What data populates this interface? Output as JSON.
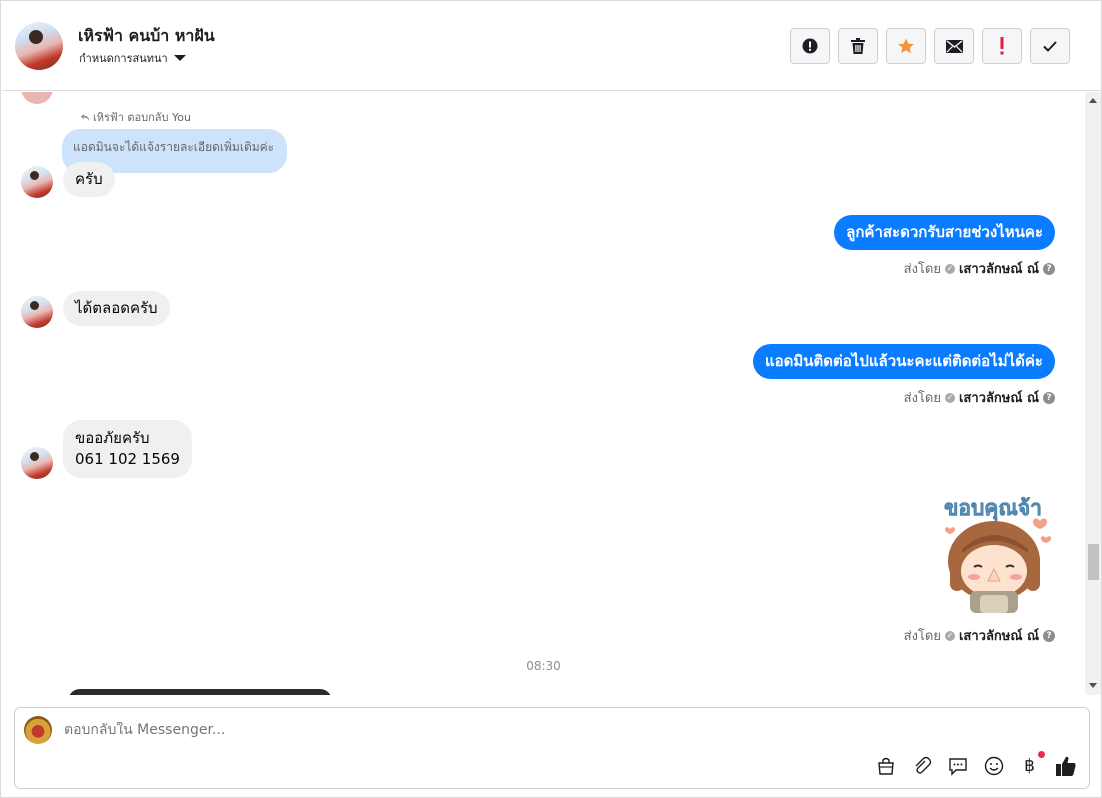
{
  "header": {
    "contact_name": "เหิรฟ้า คนบ้า หาฝัน",
    "assign_label": "กำหนดการสนทนา",
    "actions": [
      {
        "name": "spam-button",
        "icon": "alert-circle-icon"
      },
      {
        "name": "delete-button",
        "icon": "trash-icon"
      },
      {
        "name": "star-button",
        "icon": "star-icon"
      },
      {
        "name": "mark-unread-button",
        "icon": "envelope-icon"
      },
      {
        "name": "follow-up-button",
        "icon": "exclamation-icon"
      },
      {
        "name": "mark-done-button",
        "icon": "checkmark-icon"
      }
    ]
  },
  "thread": {
    "reply_context": {
      "label": "เหิรฟ้า ตอบกลับ You",
      "quoted_text": "แอดมินจะได้แจ้งรายละเอียดเพิ่มเติมค่ะ"
    },
    "messages": [
      {
        "dir": "in",
        "text": "ครับ"
      },
      {
        "dir": "out",
        "text": "ลูกค้าสะดวกรับสายช่วงไหนคะ"
      },
      {
        "dir": "in",
        "text": "ได้ตลอดครับ"
      },
      {
        "dir": "out",
        "text": "แอดมินติดต่อไปแล้วนะคะแต่ติดต่อไม่ได้ค่ะ"
      },
      {
        "dir": "in",
        "lines": [
          "ขออภัยครับ",
          "061 102 1569"
        ]
      },
      {
        "dir": "out",
        "sticker_text": "ขอบคุณจ้า"
      }
    ],
    "sent_by_prefix": "ส่งโดย",
    "sent_by_name": "เสาวลักษณ์ ณ์",
    "timestamp": "08:30"
  },
  "composer": {
    "placeholder": "ตอบกลับใน Messenger...",
    "tools": [
      "shop-icon",
      "paperclip-icon",
      "saved-replies-icon",
      "emoji-icon",
      "baht-payment-icon",
      "like-icon"
    ]
  },
  "colors": {
    "outgoing_bubble": "#0a7cff",
    "incoming_bubble": "#f0f0f0",
    "quote_bubble": "#cde3fb",
    "star": "#f7923b",
    "follow_up": "#e41e3f"
  }
}
